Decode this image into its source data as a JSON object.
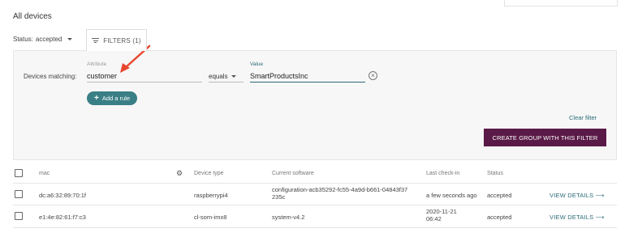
{
  "page": {
    "title": "All devices"
  },
  "status_filter": {
    "label": "Status:",
    "value": "accepted"
  },
  "filters_tab": {
    "label": "FILTERS (1)"
  },
  "filter_panel": {
    "devices_matching_label": "Devices matching:",
    "attribute_label": "Attribute",
    "attribute_value": "customer",
    "operator": "equals",
    "value_label": "Value",
    "value_value": "SmartProductsInc",
    "add_rule_label": "Add a rule",
    "clear_filter_label": "Clear filter",
    "create_group_label": "CREATE GROUP WITH THIS FILTER"
  },
  "table": {
    "headers": {
      "mac": "mac",
      "device_type": "Device type",
      "current_software": "Current software",
      "last_checkin": "Last check-in",
      "status": "Status"
    },
    "rows": [
      {
        "mac": "dc:a6:32:89:70:1f",
        "device_type": "raspberrypi4",
        "software_line1": "configuration-acb35292-fc55-4a9d-b661-04843f37",
        "software_line2": "235c",
        "last_checkin": "a few seconds ago",
        "status": "accepted",
        "action": "VIEW DETAILS ⟶"
      },
      {
        "mac": "e1:4e:82:61:f7:c3",
        "device_type": "cl-som-imx8",
        "software_line1": "system-v4.2",
        "last_checkin_line1": "2020-11-21",
        "last_checkin_line2": "06:42",
        "status": "accepted",
        "action": "VIEW DETAILS ⟶"
      }
    ]
  },
  "colors": {
    "accent": "#2a6a78",
    "primary_button": "#5a1a47",
    "add_rule_button": "#3a7f85",
    "annotation_arrow": "#e8472f"
  }
}
